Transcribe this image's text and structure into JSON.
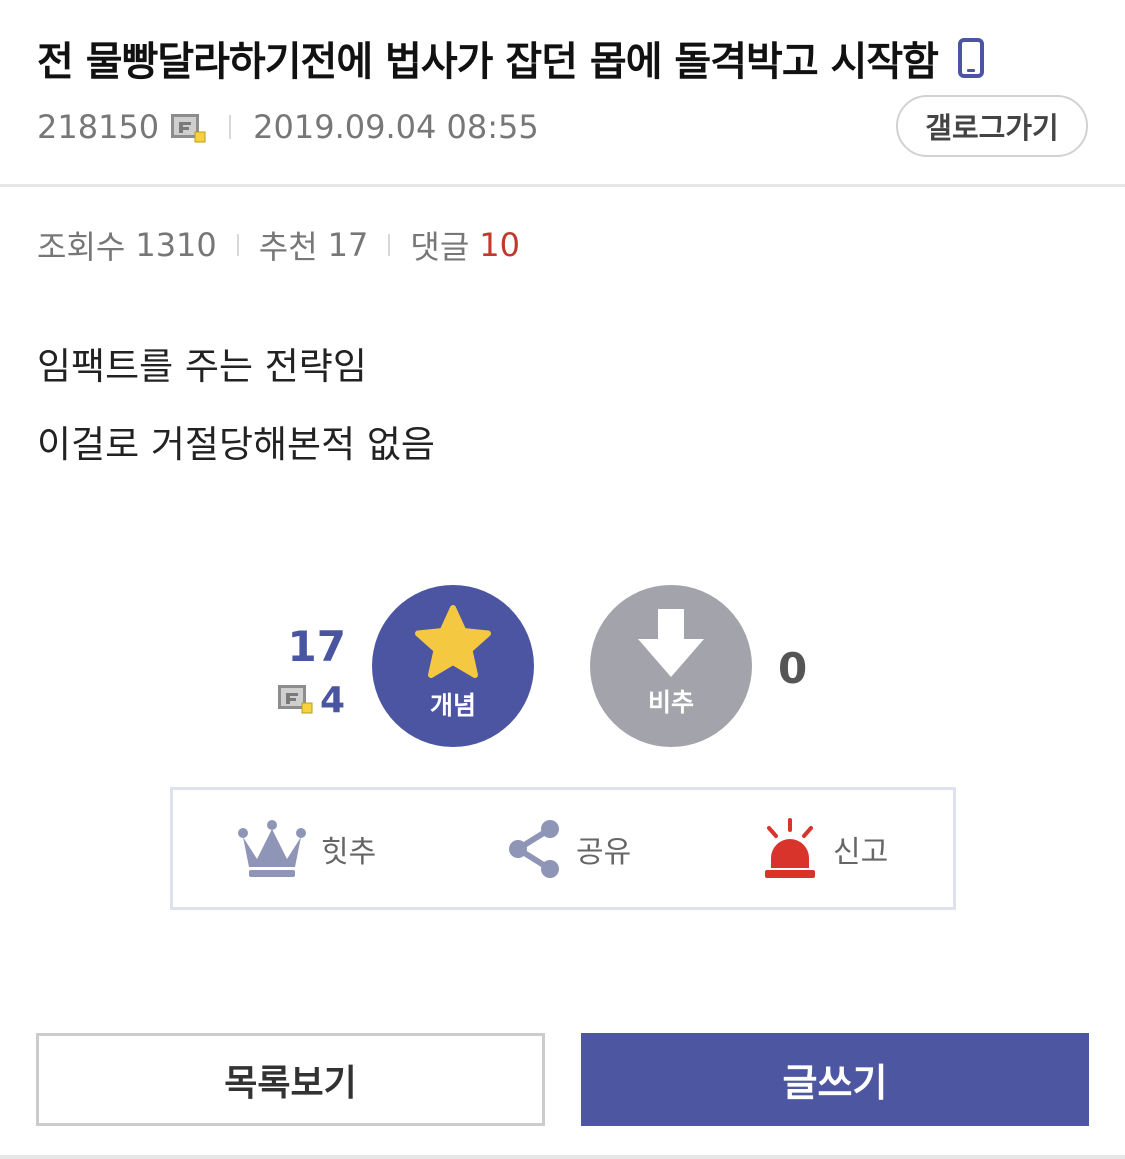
{
  "post": {
    "title": "전 물빵달라하기전에 법사가 잡던 몹에 돌격박고 시작함",
    "author_id": "218150",
    "datetime": "2019.09.04 08:55",
    "gallog_label": "갤로그가기"
  },
  "stats": {
    "views_label": "조회수",
    "views": "1310",
    "recommend_label": "추천",
    "recommend": "17",
    "comments_label": "댓글",
    "comments": "10"
  },
  "body": {
    "lines": [
      "임팩트를 주는 전략임",
      "이걸로 거절당해본적 없음"
    ]
  },
  "vote": {
    "up_count": "17",
    "fixed_count": "4",
    "up_label": "개념",
    "down_label": "비추",
    "down_count": "0"
  },
  "actions": {
    "hit_label": "힛추",
    "share_label": "공유",
    "report_label": "신고"
  },
  "bottom": {
    "list_label": "목록보기",
    "write_label": "글쓰기"
  },
  "colors": {
    "accent": "#4c55a2",
    "comment_count": "#c0392b",
    "star": "#f5c842",
    "report_red": "#d9342b",
    "downvote_gray": "#a3a4ab"
  }
}
